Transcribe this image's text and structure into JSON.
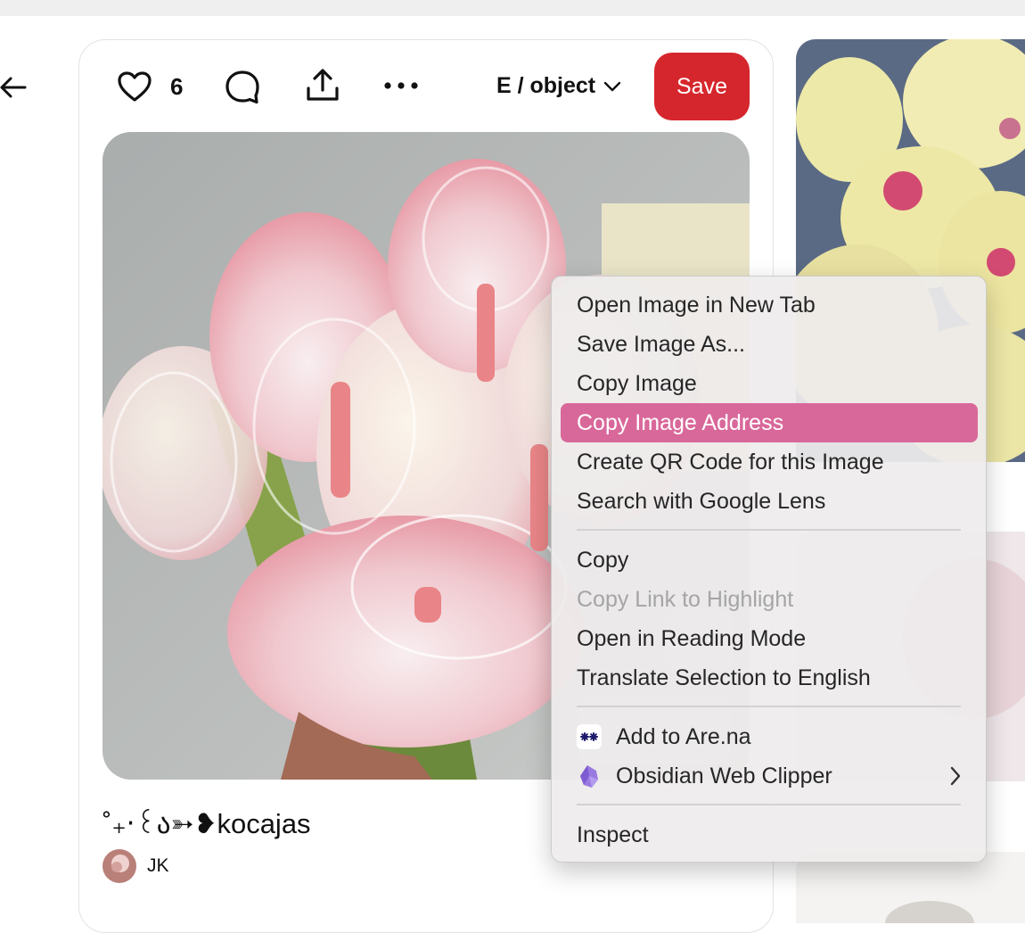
{
  "pin": {
    "like_count": "6",
    "board_label": "E / object",
    "save_label": "Save",
    "title": "˚₊‧꒰ა➳❥kocajas",
    "author_initials": "JK"
  },
  "context_menu": {
    "items": [
      {
        "label": "Open Image in New Tab"
      },
      {
        "label": "Save Image As..."
      },
      {
        "label": "Copy Image"
      },
      {
        "label": "Copy Image Address"
      },
      {
        "label": "Create QR Code for this Image"
      },
      {
        "label": "Search with Google Lens"
      },
      {
        "label": "Copy"
      },
      {
        "label": "Copy Link to Highlight"
      },
      {
        "label": "Open in Reading Mode"
      },
      {
        "label": "Translate Selection to English"
      },
      {
        "label": "Add to Are.na"
      },
      {
        "label": "Obsidian Web Clipper"
      },
      {
        "label": "Inspect"
      }
    ],
    "highlighted_item": "Copy Image Address",
    "disabled_item": "Copy Link to Highlight"
  },
  "colors": {
    "save_button": "#d6262d",
    "menu_highlight": "#d9689a"
  },
  "icons": [
    "back-arrow-icon",
    "heart-icon",
    "comment-icon",
    "share-icon",
    "more-icon",
    "chevron-down-icon",
    "arena-icon",
    "obsidian-icon",
    "chevron-right-icon"
  ]
}
